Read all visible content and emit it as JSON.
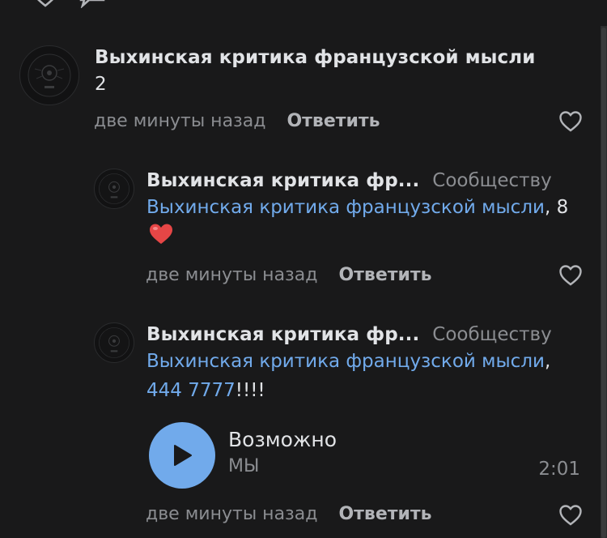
{
  "comments": [
    {
      "author": "Выхинская критика французской мысли",
      "text": "2",
      "time": "две минуты назад",
      "reply": "Ответить"
    },
    {
      "author": "Выхинская критика фр...",
      "to": "Сообществу",
      "mention": "Выхинская критика французской мысли",
      "text_rest": ", 8",
      "emoji": "❤️",
      "time": "две минуты назад",
      "reply": "Ответить"
    },
    {
      "author": "Выхинская критика фр...",
      "to": "Сообществу",
      "mention": "Выхинская критика французской мысли",
      "sep": ",",
      "phone": "444 7777",
      "text_rest": "!!!!",
      "audio": {
        "title": "Возможно",
        "artist": "МЫ",
        "duration": "2:01"
      },
      "time": "две минуты назад",
      "reply": "Ответить"
    }
  ],
  "icons": {
    "like": "heart-outline-icon",
    "play": "play-icon",
    "avatar": "community-avatar"
  },
  "colors": {
    "background": "#19191a",
    "text": "#e1e3e6",
    "secondary": "#8b8d91",
    "link": "#71aaeb",
    "play_button": "#71aaeb",
    "heart": "#e64646"
  }
}
